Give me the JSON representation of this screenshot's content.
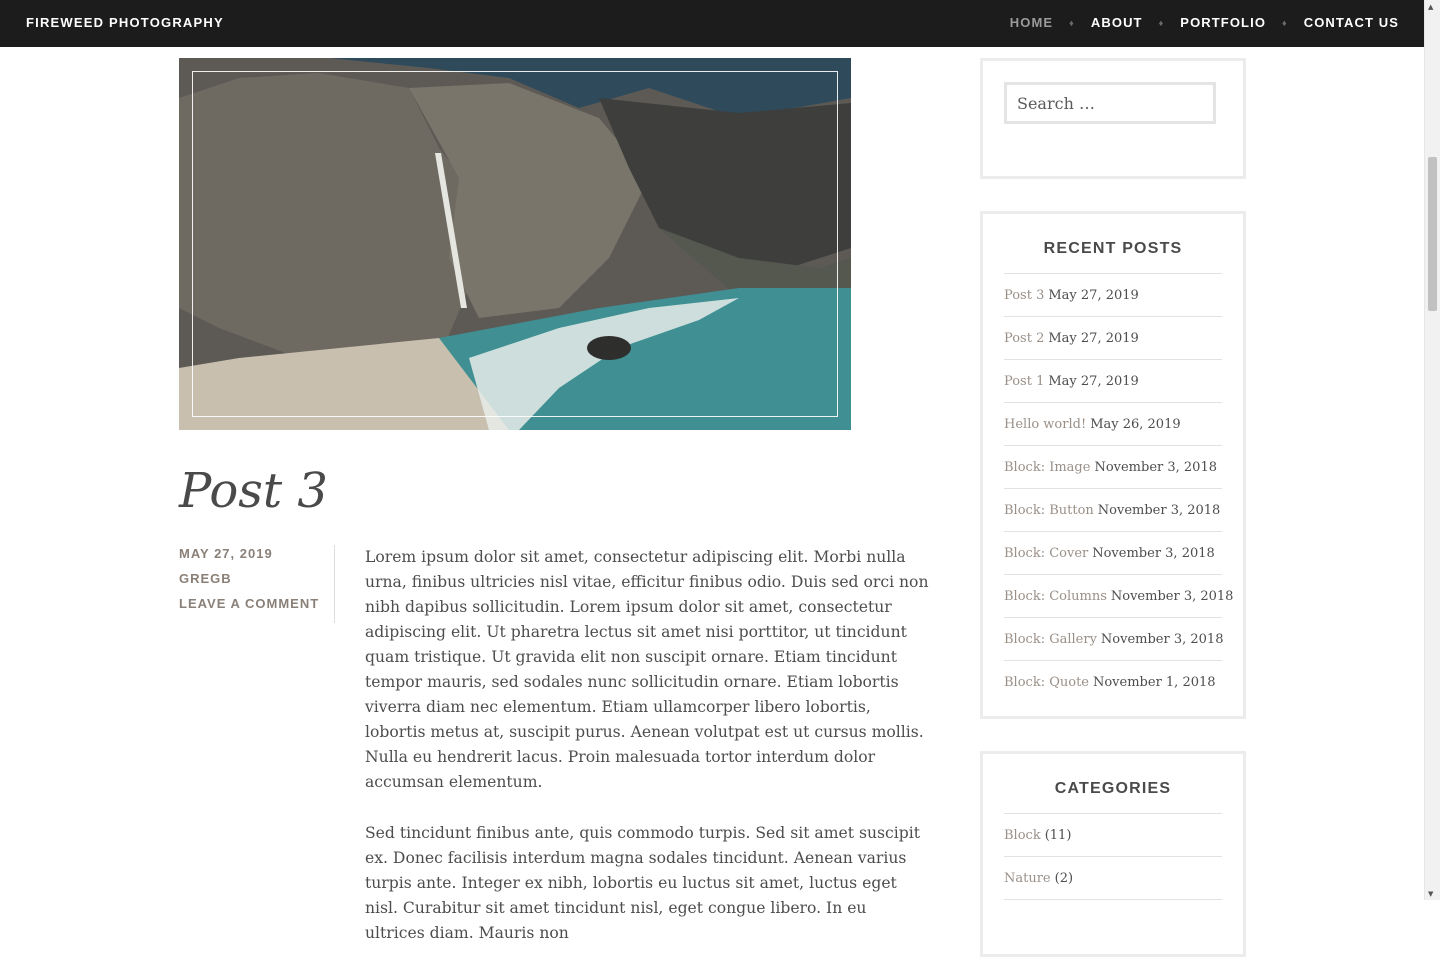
{
  "site": {
    "title": "FIREWEED PHOTOGRAPHY"
  },
  "nav": {
    "items": [
      {
        "label": "HOME",
        "active": true
      },
      {
        "label": "ABOUT"
      },
      {
        "label": "PORTFOLIO"
      },
      {
        "label": "CONTACT US"
      }
    ],
    "separator": "♦"
  },
  "post": {
    "title": "Post 3",
    "date": "MAY 27, 2019",
    "author": "GREGB",
    "comment_link": "LEAVE A COMMENT",
    "paragraphs": [
      "Lorem ipsum dolor sit amet, consectetur adipiscing elit. Morbi nulla urna, finibus ultricies nisl vitae, efficitur finibus odio. Duis sed orci non nibh dapibus sollicitudin. Lorem ipsum dolor sit amet, consectetur adipiscing elit. Ut pharetra lectus sit amet nisi porttitor, ut tincidunt quam tristique. Ut gravida elit non suscipit ornare. Etiam tincidunt tempor mauris, sed sodales nunc sollicitudin ornare. Etiam lobortis viverra diam nec elementum. Etiam ullamcorper libero lobortis, lobortis metus at, suscipit purus. Aenean volutpat est ut cursus mollis. Nulla eu hendrerit lacus. Proin malesuada tortor interdum dolor accumsan elementum.",
      "Sed tincidunt finibus ante, quis commodo turpis. Sed sit amet suscipit ex. Donec facilisis interdum magna sodales tincidunt. Aenean varius turpis ante. Integer ex nibh, lobortis eu luctus sit amet, luctus eget nisl. Curabitur sit amet tincidunt nisl, eget congue libero. In eu ultrices diam. Mauris non"
    ]
  },
  "search": {
    "placeholder": "Search …"
  },
  "recent_posts": {
    "title": "RECENT POSTS",
    "items": [
      {
        "title": "Post 3",
        "date": "May 27, 2019"
      },
      {
        "title": "Post 2",
        "date": "May 27, 2019"
      },
      {
        "title": "Post 1",
        "date": "May 27, 2019"
      },
      {
        "title": "Hello world!",
        "date": "May 26, 2019"
      },
      {
        "title": "Block: Image",
        "date": "November 3, 2018"
      },
      {
        "title": "Block: Button",
        "date": "November 3, 2018"
      },
      {
        "title": "Block: Cover",
        "date": "November 3, 2018"
      },
      {
        "title": "Block: Columns",
        "date": "November 3, 2018"
      },
      {
        "title": "Block: Gallery",
        "date": "November 3, 2018"
      },
      {
        "title": "Block: Quote",
        "date": "November 1, 2018"
      }
    ]
  },
  "categories": {
    "title": "CATEGORIES",
    "items": [
      {
        "name": "Block",
        "count": "(11)"
      },
      {
        "name": "Nature",
        "count": "(2)"
      }
    ]
  },
  "scrollbar": {
    "up": "▲",
    "down": "▼"
  }
}
